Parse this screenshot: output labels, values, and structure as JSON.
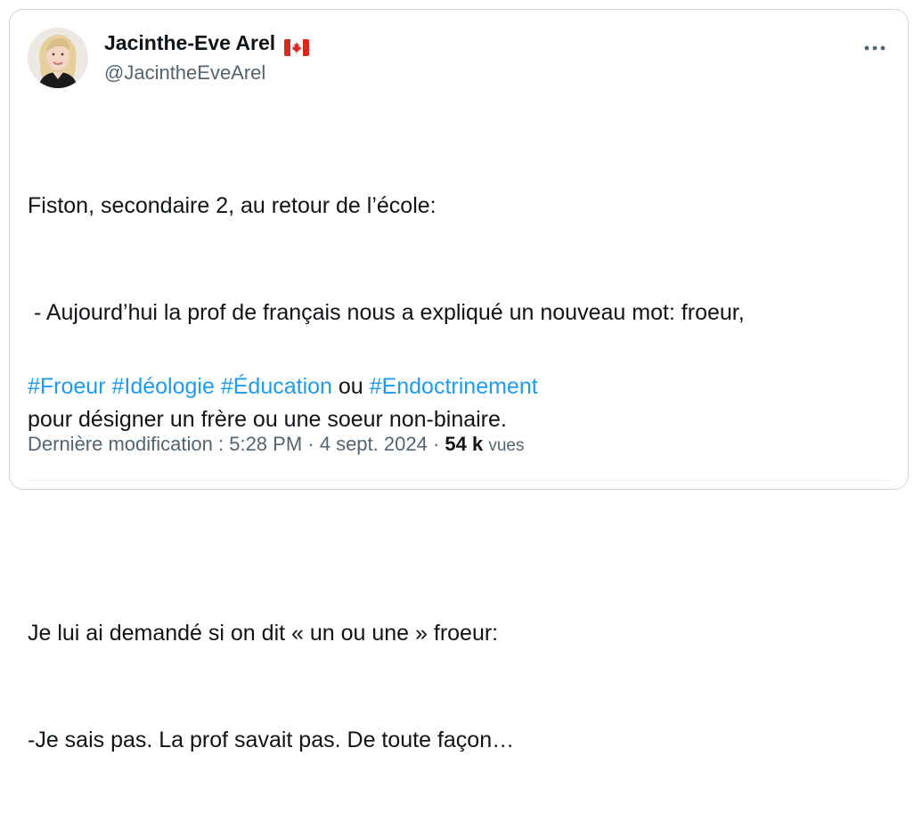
{
  "author": {
    "display_name": "Jacinthe-Eve Arel",
    "handle": "@JacintheEveArel",
    "flag_icon": "canada-flag-icon"
  },
  "tweet": {
    "line1": "Fiston, secondaire 2, au retour de l’école:",
    "line2": " - Aujourd’hui la prof de français nous a expliqué un nouveau mot: froeur,",
    "line3": "pour désigner un frère ou une soeur non-binaire.",
    "line4": "Je lui ai demandé si on dit « un ou une » froeur:",
    "line5": "-Je sais pas. La prof savait pas. De toute façon…",
    "hashtags": [
      "#Froeur",
      "#Idéologie",
      "#Éducation"
    ],
    "connector": "ou",
    "last_hashtag": "#Endoctrinement"
  },
  "meta": {
    "edited_label": "Dernière modification : ",
    "time": "5:28 PM",
    "separator": " · ",
    "date": "4 sept. 2024",
    "views_count": "54 k",
    "views_label": "vues"
  },
  "colors": {
    "link": "#1d9bf0",
    "secondary": "#536471",
    "text": "#0f1419"
  }
}
